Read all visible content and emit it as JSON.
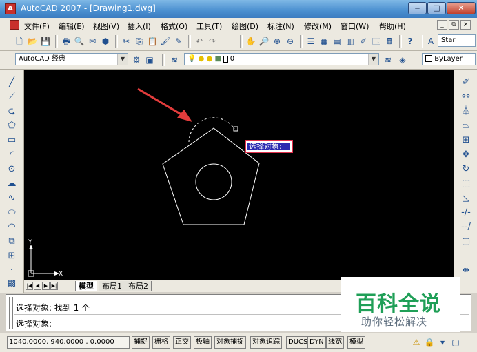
{
  "window": {
    "title": "AutoCAD 2007 - [Drawing1.dwg]",
    "app_icon": "A",
    "controls": {
      "minimize": "‒",
      "maximize": "□",
      "close": "✕"
    }
  },
  "menu": {
    "items": [
      "文件(F)",
      "编辑(E)",
      "视图(V)",
      "插入(I)",
      "格式(O)",
      "工具(T)",
      "绘图(D)",
      "标注(N)",
      "修改(M)",
      "窗口(W)",
      "帮助(H)"
    ],
    "mdi_controls": {
      "minimize": "_",
      "restore": "⧉",
      "close": "×"
    }
  },
  "toolbar": {
    "workspace": "AutoCAD 经典",
    "layer_value": "0",
    "style_value": "Star",
    "color_value": "ByLayer"
  },
  "canvas": {
    "tooltip": "选择对象:",
    "ucs_y": "Y",
    "ucs_x": "X",
    "colors": {
      "background": "#000000",
      "geometry": "#ffffff",
      "arrow": "#e23c3c",
      "tooltip_border": "#e0304c",
      "tooltip_fill": "#2a2ab0"
    }
  },
  "layout_tabs": {
    "tabs": [
      "模型",
      "布局1",
      "布局2"
    ],
    "active": "模型"
  },
  "command": {
    "lines": [
      "选择对象: 找到 1 个",
      "选择对象:"
    ]
  },
  "status": {
    "coordinates": "1040.0000, 940.0000 , 0.0000",
    "toggles": [
      "捕捉",
      "栅格",
      "正交",
      "极轴",
      "对象捕捉",
      "对象追踪",
      "DUCS",
      "DYN",
      "线宽",
      "模型"
    ]
  },
  "watermark": {
    "title": "百科全说",
    "subtitle": "助你轻松解决"
  }
}
